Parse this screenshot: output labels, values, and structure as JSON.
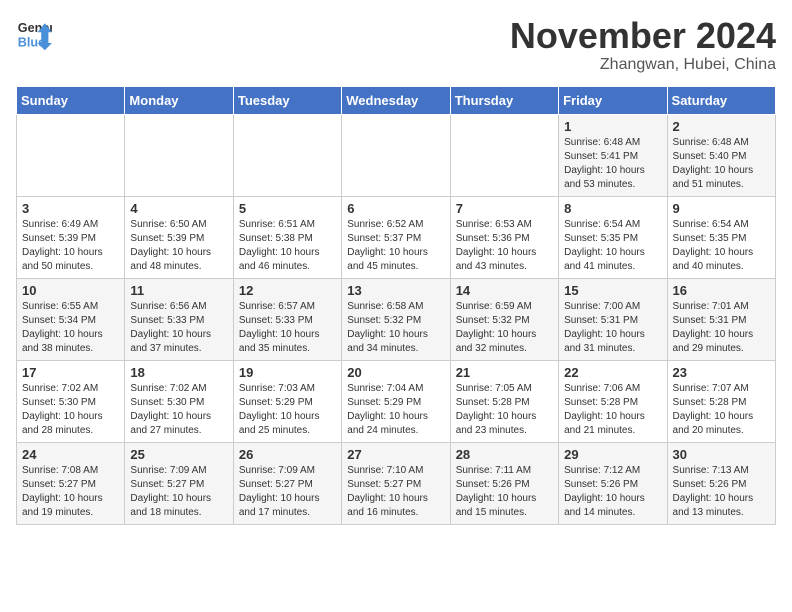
{
  "header": {
    "logo_line1": "General",
    "logo_line2": "Blue",
    "month": "November 2024",
    "location": "Zhangwan, Hubei, China"
  },
  "weekdays": [
    "Sunday",
    "Monday",
    "Tuesday",
    "Wednesday",
    "Thursday",
    "Friday",
    "Saturday"
  ],
  "weeks": [
    [
      {
        "day": "",
        "info": ""
      },
      {
        "day": "",
        "info": ""
      },
      {
        "day": "",
        "info": ""
      },
      {
        "day": "",
        "info": ""
      },
      {
        "day": "",
        "info": ""
      },
      {
        "day": "1",
        "info": "Sunrise: 6:48 AM\nSunset: 5:41 PM\nDaylight: 10 hours and 53 minutes."
      },
      {
        "day": "2",
        "info": "Sunrise: 6:48 AM\nSunset: 5:40 PM\nDaylight: 10 hours and 51 minutes."
      }
    ],
    [
      {
        "day": "3",
        "info": "Sunrise: 6:49 AM\nSunset: 5:39 PM\nDaylight: 10 hours and 50 minutes."
      },
      {
        "day": "4",
        "info": "Sunrise: 6:50 AM\nSunset: 5:39 PM\nDaylight: 10 hours and 48 minutes."
      },
      {
        "day": "5",
        "info": "Sunrise: 6:51 AM\nSunset: 5:38 PM\nDaylight: 10 hours and 46 minutes."
      },
      {
        "day": "6",
        "info": "Sunrise: 6:52 AM\nSunset: 5:37 PM\nDaylight: 10 hours and 45 minutes."
      },
      {
        "day": "7",
        "info": "Sunrise: 6:53 AM\nSunset: 5:36 PM\nDaylight: 10 hours and 43 minutes."
      },
      {
        "day": "8",
        "info": "Sunrise: 6:54 AM\nSunset: 5:35 PM\nDaylight: 10 hours and 41 minutes."
      },
      {
        "day": "9",
        "info": "Sunrise: 6:54 AM\nSunset: 5:35 PM\nDaylight: 10 hours and 40 minutes."
      }
    ],
    [
      {
        "day": "10",
        "info": "Sunrise: 6:55 AM\nSunset: 5:34 PM\nDaylight: 10 hours and 38 minutes."
      },
      {
        "day": "11",
        "info": "Sunrise: 6:56 AM\nSunset: 5:33 PM\nDaylight: 10 hours and 37 minutes."
      },
      {
        "day": "12",
        "info": "Sunrise: 6:57 AM\nSunset: 5:33 PM\nDaylight: 10 hours and 35 minutes."
      },
      {
        "day": "13",
        "info": "Sunrise: 6:58 AM\nSunset: 5:32 PM\nDaylight: 10 hours and 34 minutes."
      },
      {
        "day": "14",
        "info": "Sunrise: 6:59 AM\nSunset: 5:32 PM\nDaylight: 10 hours and 32 minutes."
      },
      {
        "day": "15",
        "info": "Sunrise: 7:00 AM\nSunset: 5:31 PM\nDaylight: 10 hours and 31 minutes."
      },
      {
        "day": "16",
        "info": "Sunrise: 7:01 AM\nSunset: 5:31 PM\nDaylight: 10 hours and 29 minutes."
      }
    ],
    [
      {
        "day": "17",
        "info": "Sunrise: 7:02 AM\nSunset: 5:30 PM\nDaylight: 10 hours and 28 minutes."
      },
      {
        "day": "18",
        "info": "Sunrise: 7:02 AM\nSunset: 5:30 PM\nDaylight: 10 hours and 27 minutes."
      },
      {
        "day": "19",
        "info": "Sunrise: 7:03 AM\nSunset: 5:29 PM\nDaylight: 10 hours and 25 minutes."
      },
      {
        "day": "20",
        "info": "Sunrise: 7:04 AM\nSunset: 5:29 PM\nDaylight: 10 hours and 24 minutes."
      },
      {
        "day": "21",
        "info": "Sunrise: 7:05 AM\nSunset: 5:28 PM\nDaylight: 10 hours and 23 minutes."
      },
      {
        "day": "22",
        "info": "Sunrise: 7:06 AM\nSunset: 5:28 PM\nDaylight: 10 hours and 21 minutes."
      },
      {
        "day": "23",
        "info": "Sunrise: 7:07 AM\nSunset: 5:28 PM\nDaylight: 10 hours and 20 minutes."
      }
    ],
    [
      {
        "day": "24",
        "info": "Sunrise: 7:08 AM\nSunset: 5:27 PM\nDaylight: 10 hours and 19 minutes."
      },
      {
        "day": "25",
        "info": "Sunrise: 7:09 AM\nSunset: 5:27 PM\nDaylight: 10 hours and 18 minutes."
      },
      {
        "day": "26",
        "info": "Sunrise: 7:09 AM\nSunset: 5:27 PM\nDaylight: 10 hours and 17 minutes."
      },
      {
        "day": "27",
        "info": "Sunrise: 7:10 AM\nSunset: 5:27 PM\nDaylight: 10 hours and 16 minutes."
      },
      {
        "day": "28",
        "info": "Sunrise: 7:11 AM\nSunset: 5:26 PM\nDaylight: 10 hours and 15 minutes."
      },
      {
        "day": "29",
        "info": "Sunrise: 7:12 AM\nSunset: 5:26 PM\nDaylight: 10 hours and 14 minutes."
      },
      {
        "day": "30",
        "info": "Sunrise: 7:13 AM\nSunset: 5:26 PM\nDaylight: 10 hours and 13 minutes."
      }
    ]
  ]
}
